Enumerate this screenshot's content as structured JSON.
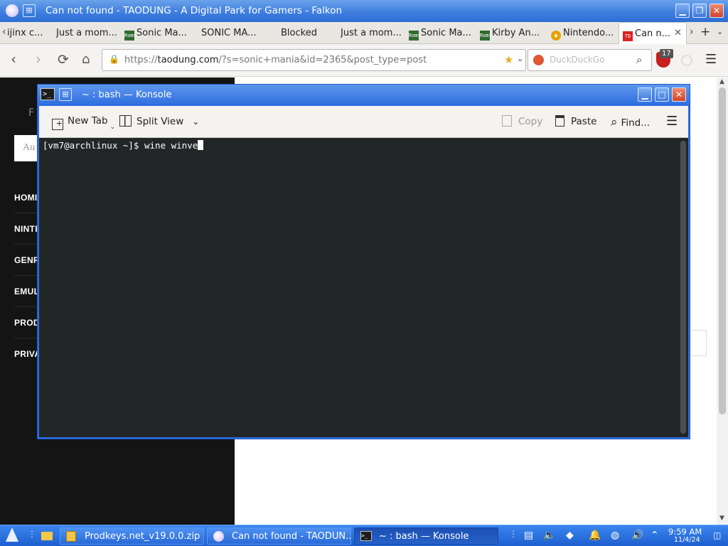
{
  "browser": {
    "window_title": "Can not found - TAODUNG - A Digital Park for Gamers - Falkon",
    "tabs": [
      {
        "label": "ijinx c...",
        "icon": "none"
      },
      {
        "label": "Just a mom...",
        "icon": "none"
      },
      {
        "label": "Sonic Ma...",
        "icon": "roms-icon"
      },
      {
        "label": "SONIC MA...",
        "icon": "none"
      },
      {
        "label": "Blocked",
        "icon": "none"
      },
      {
        "label": "Just a mom...",
        "icon": "none"
      },
      {
        "label": "Sonic Ma...",
        "icon": "roms-icon"
      },
      {
        "label": "Kirby An...",
        "icon": "roms-icon"
      },
      {
        "label": "Nintendo...",
        "icon": "nintendo-icon"
      },
      {
        "label": "Can n...",
        "icon": "taodung-icon"
      }
    ],
    "url_prefix": "https://",
    "url_host": "taodung.com",
    "url_rest": "/?s=sonic+mania&id=2365&post_type=post",
    "search_placeholder": "DuckDuckGo",
    "ublock_count": "17"
  },
  "webpage": {
    "search_fragment": "Au",
    "logo_fragment": "F",
    "nav": [
      "HOMI",
      "NINTI",
      "GENR",
      "EMUL",
      "PROD",
      "PRIVA"
    ]
  },
  "konsole": {
    "title": "~ : bash — Konsole",
    "toolbar": {
      "new_tab": "New Tab",
      "split_view": "Split View",
      "copy": "Copy",
      "paste": "Paste",
      "find": "Find..."
    },
    "terminal_line": "[vm7@archlinux ~]$ wine winve"
  },
  "taskbar": {
    "tasks": [
      {
        "label": "Prodkeys.net_v19.0.0.zip ..."
      },
      {
        "label": "Can not found - TAODUN..."
      },
      {
        "label": "~ : bash — Konsole"
      }
    ],
    "time": "9:59 AM",
    "date": "11/4/24"
  },
  "colors": {
    "titlebar": "#3f7fe0",
    "terminal_bg": "#232627",
    "web_sidebar": "#141414",
    "taskbar": "#2a6ad8"
  }
}
